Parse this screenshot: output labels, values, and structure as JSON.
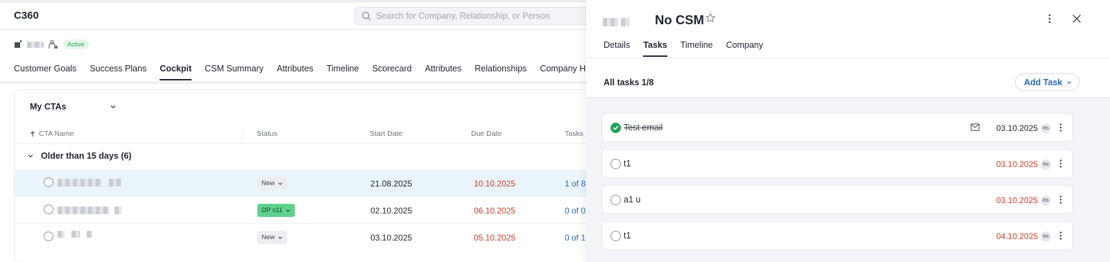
{
  "app": {
    "title": "C360",
    "search_placeholder": "Search for Company, Relationship, or Person",
    "company_status": "Active",
    "nav_tabs": [
      {
        "label": "Customer Goals"
      },
      {
        "label": "Success Plans"
      },
      {
        "label": "Cockpit",
        "active": true
      },
      {
        "label": "CSM Summary"
      },
      {
        "label": "Attributes"
      },
      {
        "label": "Timeline"
      },
      {
        "label": "Scorecard"
      },
      {
        "label": "Attributes"
      },
      {
        "label": "Relationships"
      },
      {
        "label": "Company Hiera"
      }
    ]
  },
  "cockpit": {
    "cta_filter": "My CTAs",
    "columns": {
      "name": "CTA Name",
      "status": "Status",
      "start": "Start Date",
      "due": "Due Date",
      "tasks": "Tasks"
    },
    "group_label": "Older than 15 days (6)",
    "rows": [
      {
        "status": "New",
        "start": "21.08.2025",
        "due": "10.10.2025",
        "tasks": "1 of 8"
      },
      {
        "status": "DP s11",
        "start": "02.10.2025",
        "due": "06.10.2025",
        "tasks": "0 of 0"
      },
      {
        "status": "New",
        "start": "03.10.2025",
        "due": "05.10.2025",
        "tasks": "0 of 1"
      }
    ]
  },
  "panel": {
    "title": "No CSM",
    "tabs": [
      {
        "label": "Details"
      },
      {
        "label": "Tasks",
        "active": true
      },
      {
        "label": "Timeline"
      },
      {
        "label": "Company"
      }
    ],
    "all_tasks_label": "All tasks 1/8",
    "add_task_label": "Add Task",
    "tasks": [
      {
        "name": "Test email",
        "done": true,
        "date": "03.10.2025",
        "overdue": false,
        "assignee": "RS",
        "icon": "mail-icon"
      },
      {
        "name": "t1",
        "done": false,
        "date": "03.10.2025",
        "overdue": true,
        "assignee": "RS"
      },
      {
        "name": "a1 u",
        "done": false,
        "date": "03.10.2025",
        "overdue": true,
        "assignee": "RS"
      },
      {
        "name": "t1",
        "done": false,
        "date": "04.10.2025",
        "overdue": true,
        "assignee": "RS"
      }
    ]
  },
  "colors": {
    "accent": "#2a6ab4",
    "overdue": "#c9412b",
    "done": "#22a35a",
    "active_badge": "#25a552"
  }
}
